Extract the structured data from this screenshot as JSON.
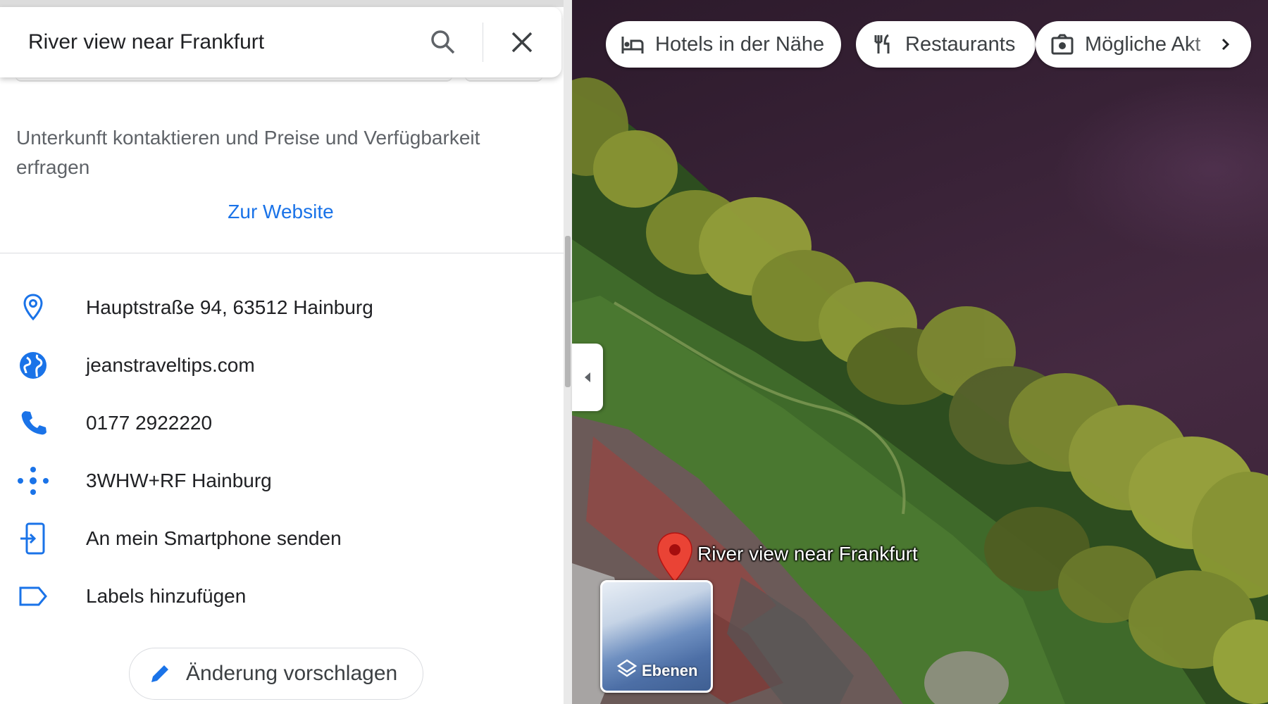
{
  "search": {
    "query": "River view near Frankfurt"
  },
  "place": {
    "booking_note": "Unterkunft kontaktieren und Preise und Verfügbarkeit erfragen",
    "website_link": "Zur Website",
    "address": "Hauptstraße 94, 63512 Hainburg",
    "website": "jeanstraveltips.com",
    "phone": "0177 2922220",
    "plus_code": "3WHW+RF Hainburg",
    "send_to_phone": "An mein Smartphone senden",
    "add_labels": "Labels hinzufügen",
    "suggest_edit": "Änderung vorschlagen"
  },
  "chips": {
    "hotels": "Hotels in der Nähe",
    "restaurants": "Restaurants",
    "things_to_do": "Mögliche Akt"
  },
  "map": {
    "pin_label": "River view near Frankfurt",
    "layers_label": "Ebenen",
    "view": "satellite"
  },
  "icons": {
    "address": "location-pin-icon",
    "website": "globe-icon",
    "phone": "phone-icon",
    "plus_code": "plus-code-icon",
    "send": "send-to-phone-icon",
    "label": "label-icon",
    "edit": "pencil-icon"
  },
  "colors": {
    "accent": "#1a73e8",
    "pin": "#ea4335",
    "text": "#202124"
  }
}
